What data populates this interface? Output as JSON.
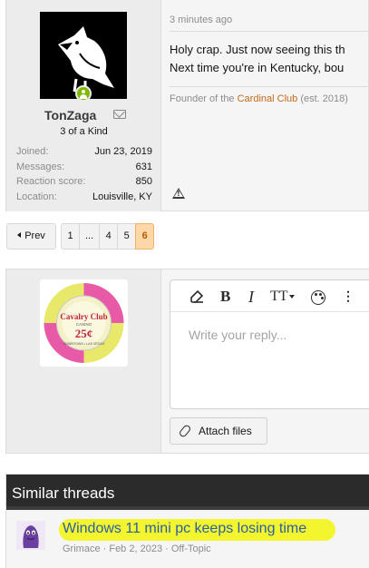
{
  "post": {
    "username": "TonZaga",
    "user_title": "3 of a Kind",
    "stats": [
      {
        "label": "Joined:",
        "value": "Jun 23, 2019"
      },
      {
        "label": "Messages:",
        "value": "631"
      },
      {
        "label": "Reaction score:",
        "value": "850"
      },
      {
        "label": "Location:",
        "value": "Louisville, KY"
      }
    ],
    "time": "3 minutes ago",
    "body_line1": "Holy crap. Just now seeing this th",
    "body_line2": "Next time you're in Kentucky, bou",
    "signature_prefix": "Founder of the ",
    "signature_link": "Cardinal Club",
    "signature_suffix": " (est. 2018)"
  },
  "pagination": {
    "prev_label": "Prev",
    "pages": [
      "1",
      "...",
      "4",
      "5",
      "6"
    ],
    "current": "6"
  },
  "reply": {
    "chip": {
      "name": "Cavalry Club",
      "line2": "CASINO",
      "denomination": "25¢",
      "ring_text": "DOWNTOWN • LAS VEGAS"
    },
    "toolbar": {
      "bold": "B",
      "italic": "I",
      "text_size": "TT",
      "more": "⋮"
    },
    "placeholder": "Write your reply...",
    "attach_label": "Attach files"
  },
  "similar": {
    "heading": "Similar threads",
    "threads": [
      {
        "title": "Windows 11 mini pc keeps losing time",
        "author": "Grimace",
        "date": "Feb 2, 2023",
        "forum": "Off-Topic",
        "highlight_color": "#f3f52f"
      }
    ]
  },
  "colors": {
    "accent": "#c46a1b",
    "current_page_bg": "#fcd7a8",
    "online": "#7fb900",
    "link": "#2b5ea8"
  }
}
